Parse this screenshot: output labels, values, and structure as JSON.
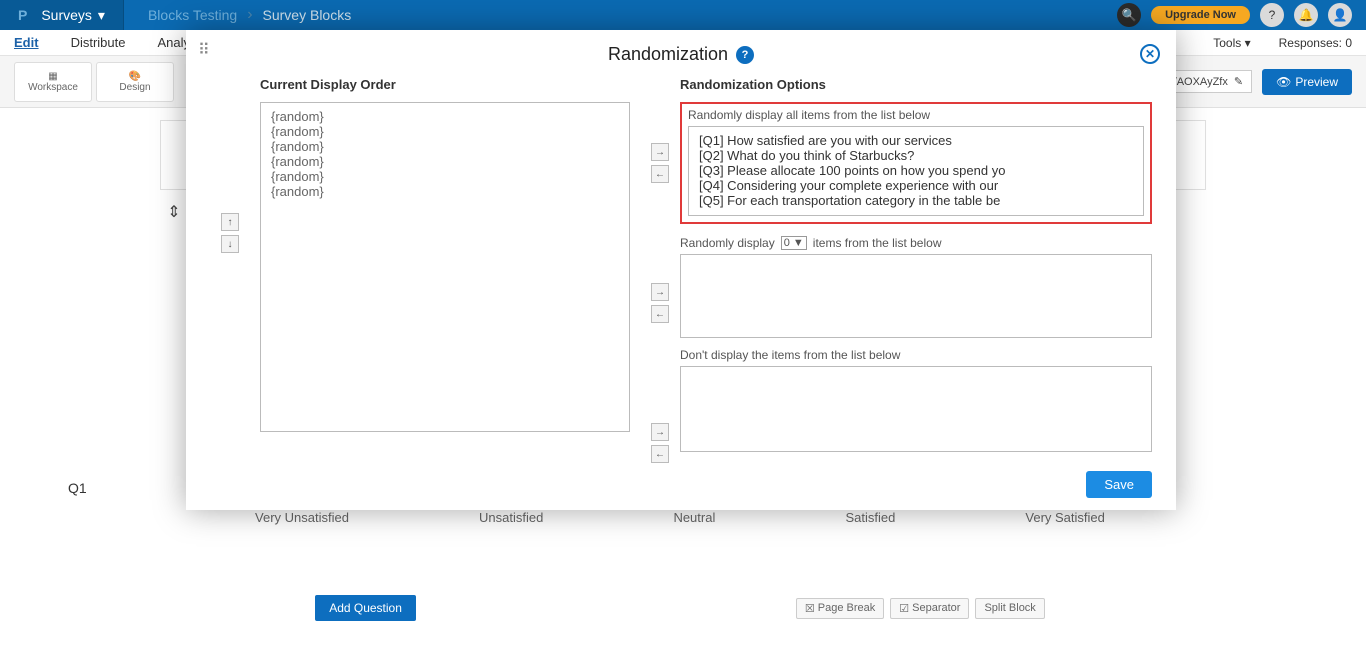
{
  "top": {
    "logo": "P",
    "surveys": "Surveys",
    "crumb1": "Blocks Testing",
    "crumb2": "Survey Blocks",
    "upgrade": "Upgrade Now"
  },
  "nav": {
    "edit": "Edit",
    "distribute": "Distribute",
    "analytics": "Analyt",
    "tools": "Tools ▾",
    "responses": "Responses: 0"
  },
  "tools": {
    "workspace": "Workspace",
    "design": "Design"
  },
  "url_tail": "t/AOXAyZfx",
  "preview": "Preview",
  "scale": {
    "s1": "Very Unsatisfied",
    "s2": "Unsatisfied",
    "s3": "Neutral",
    "s4": "Satisfied",
    "s5": "Very Satisfied"
  },
  "qid": "Q1",
  "footer": {
    "add_q": "Add Question",
    "page_break": "Page Break",
    "separator": "Separator",
    "split": "Split Block"
  },
  "modal": {
    "title": "Randomization",
    "left_title": "Current Display Order",
    "left_items": [
      "{random}",
      "{random}",
      "{random}",
      "{random}",
      "{random}",
      "{random}"
    ],
    "right_title": "Randomization Options",
    "all_label": "Randomly display all items from the list below",
    "questions": [
      "[Q1] How satisfied are you with our services",
      "[Q2] What do you think of Starbucks?",
      "[Q3] Please allocate 100 points on how you spend yo",
      "[Q4] Considering your complete experience with our",
      "[Q5] For each transportation category in the table be"
    ],
    "count_label_a": "Randomly display",
    "count_value": "0 ▼",
    "count_label_b": "items from the list below",
    "dont_label": "Don't display the items from the list below",
    "save": "Save"
  }
}
